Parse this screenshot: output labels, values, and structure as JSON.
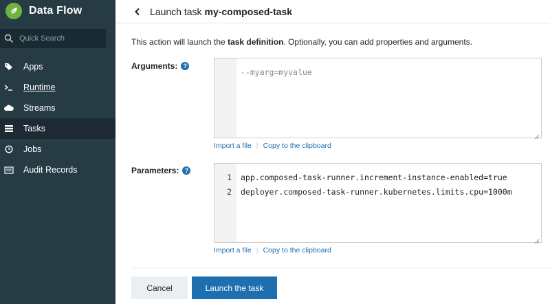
{
  "sidebar": {
    "brand": "Data Flow",
    "search": {
      "placeholder": "Quick Search"
    },
    "items": [
      {
        "label": "Apps",
        "icon": "tags-icon"
      },
      {
        "label": "Runtime",
        "icon": "terminal-icon"
      },
      {
        "label": "Streams",
        "icon": "cloud-icon"
      },
      {
        "label": "Tasks",
        "icon": "tasks-icon"
      },
      {
        "label": "Jobs",
        "icon": "clock-icon"
      },
      {
        "label": "Audit Records",
        "icon": "list-icon"
      }
    ],
    "active": "Tasks"
  },
  "header": {
    "prefix": "Launch task",
    "task_name": "my-composed-task"
  },
  "intro": {
    "before": "This action will launch the ",
    "bold": "task definition",
    "after": ". Optionally, you can add properties and arguments."
  },
  "arguments": {
    "label": "Arguments:",
    "placeholder": "--myarg=myvalue",
    "import_link": "Import a file",
    "copy_link": "Copy to the clipboard"
  },
  "parameters": {
    "label": "Parameters:",
    "lines": [
      {
        "num": "1",
        "text": "app.composed-task-runner.increment-instance-enabled=true"
      },
      {
        "num": "2",
        "text": "deployer.composed-task-runner.kubernetes.limits.cpu=1000m"
      }
    ],
    "import_link": "Import a file",
    "copy_link": "Copy to the clipboard"
  },
  "actions": {
    "cancel": "Cancel",
    "launch": "Launch the task"
  },
  "colors": {
    "sidebar_bg": "#273b45",
    "accent": "#1e6fb0",
    "brand_green": "#6db33f"
  }
}
